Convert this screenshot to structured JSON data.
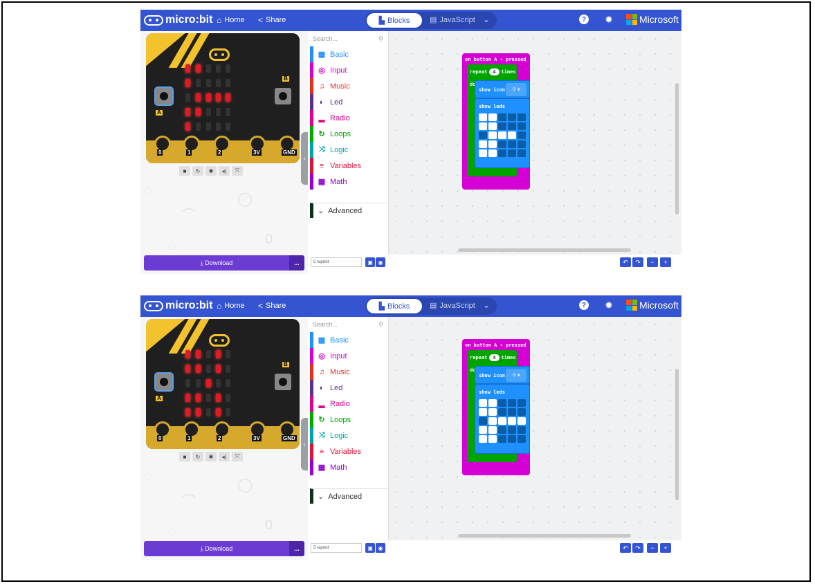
{
  "header": {
    "brand": "micro:bit",
    "home_label": "Home",
    "share_label": "Share",
    "blocks_label": "Blocks",
    "javascript_label": "JavaScript",
    "microsoft_label": "Microsoft"
  },
  "toolbox": {
    "search_placeholder": "Search...",
    "categories": [
      {
        "label": "Basic",
        "color": "#1e90ff",
        "icon": "grid-icon"
      },
      {
        "label": "Input",
        "color": "#d400d4",
        "icon": "target-icon"
      },
      {
        "label": "Music",
        "color": "#e63022",
        "icon": "headphones-icon"
      },
      {
        "label": "Led",
        "color": "#5c2d91",
        "icon": "toggle-icon"
      },
      {
        "label": "Radio",
        "color": "#e3008c",
        "icon": "signal-icon"
      },
      {
        "label": "Loops",
        "color": "#00aa00",
        "icon": "refresh-icon"
      },
      {
        "label": "Logic",
        "color": "#00a4a6",
        "icon": "shuffle-icon"
      },
      {
        "label": "Variables",
        "color": "#dc143c",
        "icon": "list-icon"
      },
      {
        "label": "Math",
        "color": "#9400d3",
        "icon": "calculator-icon"
      }
    ],
    "advanced_label": "Advanced"
  },
  "footer": {
    "download_label": "Download",
    "more_label": "...",
    "project_name": "5 rapred"
  },
  "blocks": {
    "event_label": "on button  A ▾  pressed",
    "repeat_label": "repeat",
    "repeat_count": "4",
    "times_label": "times",
    "do_label": "do",
    "show_icon_label": "show icon",
    "show_leds_label": "show leds"
  },
  "board": {
    "pins": [
      "0",
      "1",
      "2",
      "3V",
      "GND"
    ],
    "button_a": "A",
    "button_b": "B"
  },
  "panels": [
    {
      "leds": [
        [
          1,
          1,
          0,
          0,
          0
        ],
        [
          1,
          0,
          0,
          0,
          0
        ],
        [
          0,
          1,
          1,
          1,
          1
        ],
        [
          1,
          1,
          0,
          0,
          0
        ],
        [
          1,
          0,
          0,
          0,
          0
        ]
      ],
      "editor_leds": [
        [
          1,
          1,
          0,
          0,
          0
        ],
        [
          1,
          1,
          0,
          0,
          0
        ],
        [
          0,
          1,
          1,
          1,
          0
        ],
        [
          1,
          1,
          0,
          0,
          0
        ],
        [
          1,
          1,
          0,
          0,
          0
        ]
      ]
    },
    {
      "leds": [
        [
          1,
          1,
          0,
          1,
          0
        ],
        [
          1,
          1,
          0,
          1,
          0
        ],
        [
          0,
          0,
          1,
          0,
          0
        ],
        [
          1,
          1,
          0,
          1,
          0
        ],
        [
          1,
          1,
          0,
          1,
          0
        ]
      ],
      "editor_leds": [
        [
          1,
          1,
          0,
          0,
          0
        ],
        [
          1,
          1,
          0,
          0,
          0
        ],
        [
          0,
          1,
          1,
          1,
          1
        ],
        [
          1,
          1,
          0,
          0,
          0
        ],
        [
          1,
          1,
          0,
          0,
          0
        ]
      ]
    }
  ]
}
